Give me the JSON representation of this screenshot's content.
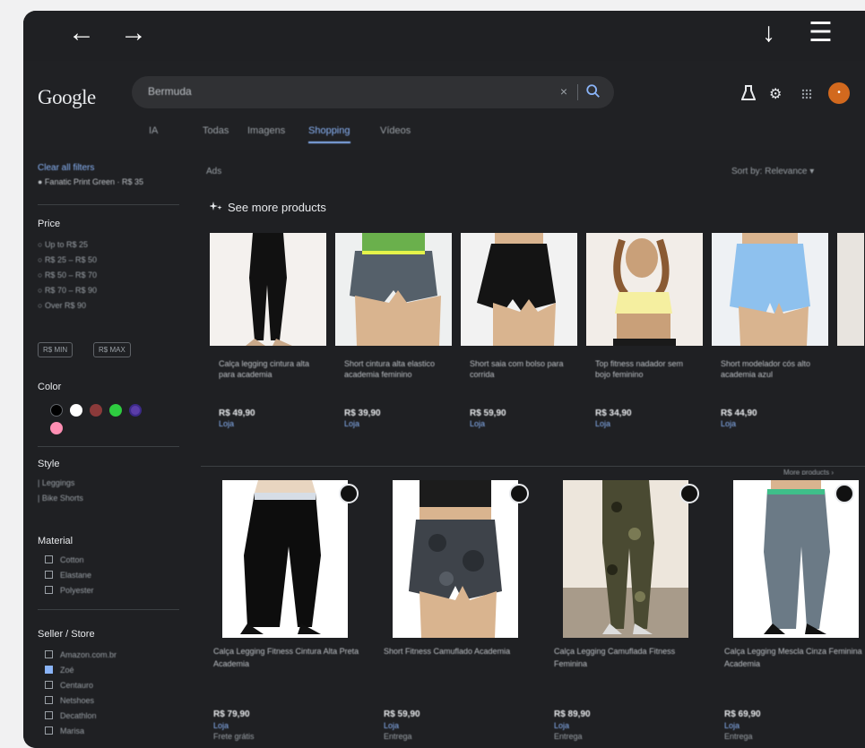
{
  "browser": {
    "back": "←",
    "forward": "→",
    "download": "↓",
    "menu": "☰"
  },
  "google": {
    "logo": "Google",
    "search_value": "Bermuda",
    "clear": "×",
    "avatar": "•"
  },
  "tabs": [
    "IA",
    "Todas",
    "Imagens",
    "Shopping",
    "Vídeos"
  ],
  "sidebar": {
    "clear_filters": "Clear all filters",
    "active_filter": "● Fanatic Print Green · R$ 35",
    "price": {
      "title": "Price",
      "options": [
        "Up to R$ 25",
        "R$ 25 – R$ 50",
        "R$ 50 – R$ 70",
        "R$ 70 – R$ 90",
        "Over R$ 90"
      ],
      "min": "R$ MIN",
      "max": "R$ MAX"
    },
    "color": {
      "title": "Color"
    },
    "style": {
      "title": "Style",
      "items": [
        "Leggings",
        "Bike Shorts"
      ]
    },
    "material": {
      "title": "Material",
      "items": [
        "Cotton",
        "Elastane",
        "Polyester"
      ]
    },
    "seller": {
      "title": "Seller / Store",
      "items": [
        "Amazon.com.br",
        "Zoé",
        "Centauro",
        "Netshoes",
        "Decathlon",
        "Marisa"
      ]
    }
  },
  "main": {
    "results_label": "Ads",
    "sort_label": "Sort by: Relevance ▾",
    "section_title": "See more products",
    "more_label": "More products ›",
    "colors": {
      "swatches": [
        "#000000",
        "#ffffff",
        "#8b3a3a",
        "#2ecc40",
        "#5b3da8",
        "#ff8fb3"
      ]
    },
    "featured": [
      {
        "title": "Calça legging cintura alta para academia",
        "price": "R$ 49,90",
        "store": "Loja"
      },
      {
        "title": "Short cintura alta elastico academia feminino",
        "price": "R$ 39,90",
        "store": "Loja"
      },
      {
        "title": "Short saia com bolso para corrida",
        "price": "R$ 59,90",
        "store": "Loja"
      },
      {
        "title": "Top fitness nadador sem bojo feminino",
        "price": "R$ 34,90",
        "store": "Loja"
      },
      {
        "title": "Short modelador cós alto academia azul",
        "price": "R$ 44,90",
        "store": "Loja"
      }
    ],
    "products": [
      {
        "title": "Calça Legging Fitness Cintura Alta Preta Academia",
        "price": "R$ 79,90",
        "store": "Loja",
        "extra": "Frete grátis"
      },
      {
        "title": "Short Fitness Camuflado Academia",
        "price": "R$ 59,90",
        "store": "Loja",
        "extra": "Entrega"
      },
      {
        "title": "Calça Legging Camuflada Fitness Feminina",
        "price": "R$ 89,90",
        "store": "Loja",
        "extra": "Entrega"
      },
      {
        "title": "Calça Legging Mescla Cinza Feminina Academia",
        "price": "R$ 69,90",
        "store": "Loja",
        "extra": "Entrega"
      }
    ]
  }
}
